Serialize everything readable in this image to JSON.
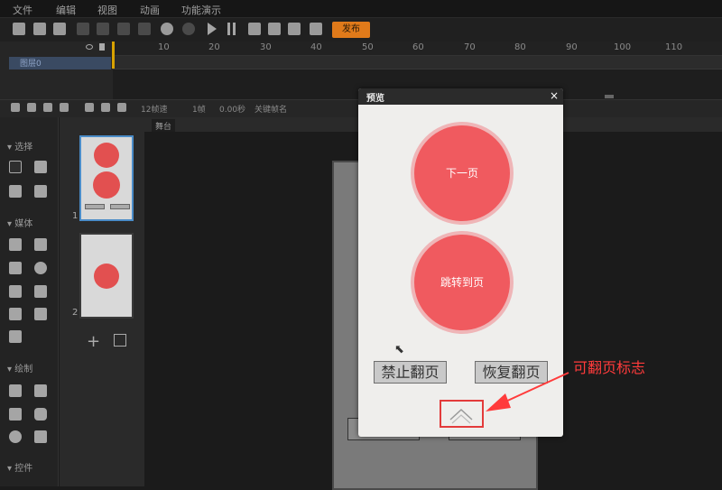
{
  "menu": [
    "文件",
    "编辑",
    "视图",
    "动画",
    "功能演示"
  ],
  "toolbar": {
    "publish_label": "发布"
  },
  "timeline": {
    "ruler_numbers": [
      "10",
      "20",
      "30",
      "40",
      "50",
      "60",
      "70",
      "80",
      "90",
      "100",
      "110"
    ],
    "layer_name": "图层0",
    "fps": "12帧速",
    "frame_count": "1帧",
    "time": "0.00秒",
    "keyframe_label": "关键帧名"
  },
  "tools": {
    "section_select": "选择",
    "section_media": "媒体",
    "section_draw": "绘制",
    "section_controls": "控件"
  },
  "pages": {
    "page1_num": "1",
    "page2_num": "2"
  },
  "stage": {
    "tab_label": "舞台"
  },
  "preview": {
    "title": "预览",
    "close_glyph": "×",
    "next_page_label": "下一页",
    "jump_page_label": "跳转到页",
    "disable_flip_label": "禁止翻页",
    "restore_flip_label": "恢复翻页"
  },
  "annotation": {
    "label": "可翻页标志",
    "color": "#ff3b3b"
  },
  "colors": {
    "accent_red": "#f05a5f",
    "publish_orange": "#e07a1a",
    "playhead": "#d8a200"
  }
}
